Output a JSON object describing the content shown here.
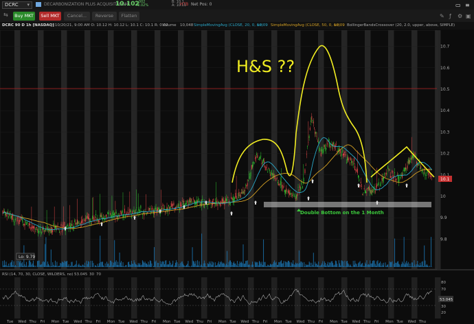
{
  "header": {
    "symbol": "DCRC",
    "company": "DECARBONIZATION PLUS ACQUISITI COM",
    "last_price": "10.102",
    "change": "+.002",
    "change_pct": "+0.02%",
    "mini_quote": "B: 10.1\nA: 10.11",
    "htb": "HTB",
    "net_pos": "Net Pos: 0"
  },
  "toolbar": {
    "buy": "Buy MKT",
    "sell": "Sell MKT",
    "cancel": "Cancel...",
    "reverse": "Reverse",
    "flatten": "Flatten"
  },
  "study_bar": {
    "title": "DCRC 90 D 1h [NASDAQ]",
    "ohlc": "D: 10/20/21, 9:00 AM   O: 10.12   H: 10.12   L: 10.1   C: 10.1   R: 0.02",
    "volume_label": "Volume",
    "volume_value": "10,048",
    "sma20": "SimpleMovingAvg (CLOSE, 20, 0, no)",
    "sma20_val": "10.09",
    "sma50": "SimpleMovingAvg (CLOSE, 50, 0, no)",
    "sma50_val": "10.09",
    "bb": "BollingerBandsCrossover (20, 2.0, upper, above, SIMPLE)"
  },
  "price_axis": [
    "10.7",
    "10.6",
    "10.5",
    "10.4",
    "10.3",
    "10.2",
    "10.1",
    "10",
    "9.9",
    "9.8"
  ],
  "current_price_tag": "10.1",
  "low_label": "Lo: 9.79",
  "annotations": {
    "hs": "H&S ??",
    "double_bottom": "Double Bottom on the 1 Month"
  },
  "rsi": {
    "label": "RSI (14, 70, 30, CLOSE, WILDERS, no)",
    "value": "53.045",
    "levels": [
      "30",
      "70"
    ],
    "axis": [
      "80",
      "70",
      "30",
      "20"
    ],
    "tag": "53.045"
  },
  "x_axis": [
    "Tue",
    "Wed",
    "Thu",
    "Fri",
    "Mon",
    "Tue",
    "Wed",
    "Thu",
    "Fri",
    "Mon",
    "Tue",
    "Wed",
    "Thu",
    "Fri",
    "Mon",
    "Tue",
    "Wed",
    "Thu",
    "Fri",
    "Mon",
    "Tue",
    "Wed",
    "Thu",
    "Fri",
    "Mon",
    "Tue",
    "Wed",
    "Thu",
    "Fri",
    "Mon",
    "Tue",
    "Wed",
    "Thu",
    "Fri",
    "Mon",
    "Tue",
    "Wed",
    "Thu"
  ],
  "colors": {
    "up": "#2ec22e",
    "down": "#e04848",
    "sma20": "#2aa8c9",
    "sma50": "#d4a024",
    "annotation": "#f2ee22",
    "resistance": "#b22222",
    "double_bottom": "#3cc83c"
  }
}
